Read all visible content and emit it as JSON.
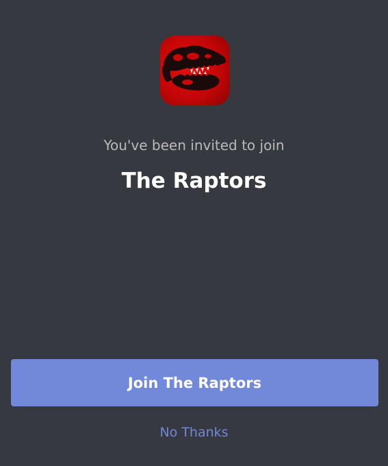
{
  "invite": {
    "server_icon": "dinosaur-skull-icon",
    "invited_text": "You've been invited to join",
    "server_name": "The Raptors",
    "join_button_label": "Join The Raptors",
    "decline_label": "No Thanks"
  },
  "colors": {
    "background": "#36393f",
    "accent": "#7289da",
    "icon_red": "#d00808",
    "muted_text": "#b9bbbe",
    "title_text": "#ffffff"
  }
}
